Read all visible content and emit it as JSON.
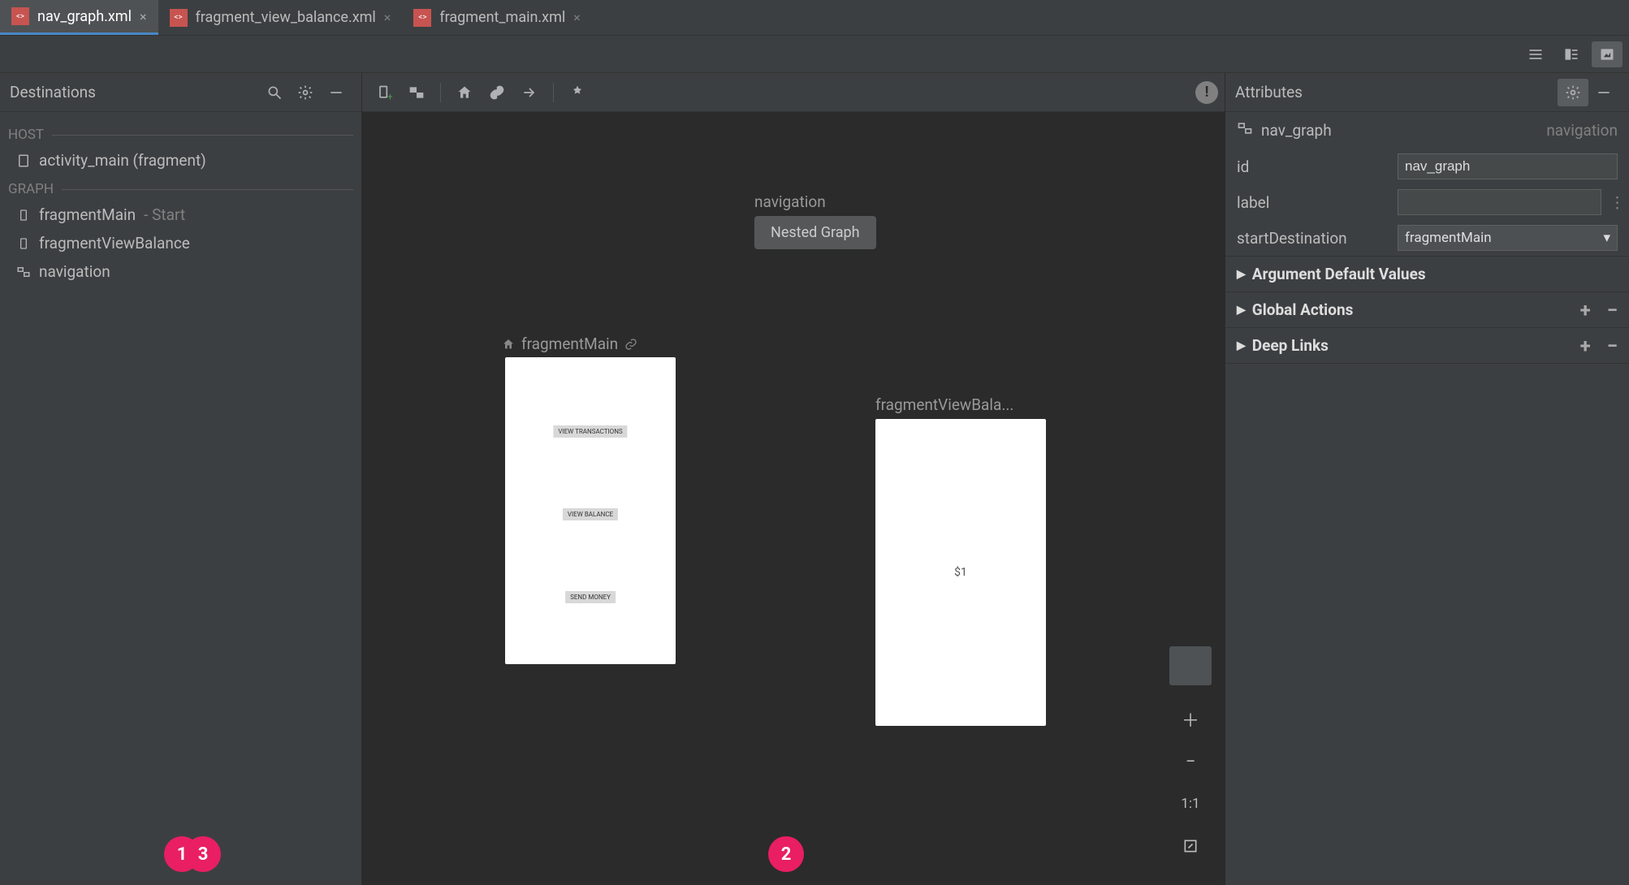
{
  "tabs": [
    {
      "label": "nav_graph.xml",
      "active": true
    },
    {
      "label": "fragment_view_balance.xml",
      "active": false
    },
    {
      "label": "fragment_main.xml",
      "active": false
    }
  ],
  "left": {
    "title": "Destinations",
    "host_label": "HOST",
    "host_item": "activity_main (fragment)",
    "graph_label": "GRAPH",
    "items": [
      {
        "name": "fragmentMain",
        "suffix": "- Start",
        "icon": "phone"
      },
      {
        "name": "fragmentViewBalance",
        "suffix": "",
        "icon": "phone"
      },
      {
        "name": "navigation",
        "suffix": "",
        "icon": "nested"
      }
    ]
  },
  "canvas": {
    "nav_label": "navigation",
    "nested_label": "Nested Graph",
    "frag_main_label": "fragmentMain",
    "frag_view_label": "fragmentViewBala...",
    "main_buttons": [
      "VIEW TRANSACTIONS",
      "VIEW BALANCE",
      "SEND MONEY"
    ],
    "view_text": "$1"
  },
  "right": {
    "title": "Attributes",
    "element_name": "nav_graph",
    "element_type": "navigation",
    "rows": {
      "id": {
        "label": "id",
        "value": "nav_graph"
      },
      "label": {
        "label": "label",
        "value": ""
      },
      "startDestination": {
        "label": "startDestination",
        "value": "fragmentMain"
      }
    },
    "sections": [
      {
        "label": "Argument Default Values",
        "actions": false
      },
      {
        "label": "Global Actions",
        "actions": true
      },
      {
        "label": "Deep Links",
        "actions": true
      }
    ]
  },
  "zoom": {
    "one_to_one": "1:1"
  },
  "markers": [
    "1",
    "2",
    "3"
  ]
}
